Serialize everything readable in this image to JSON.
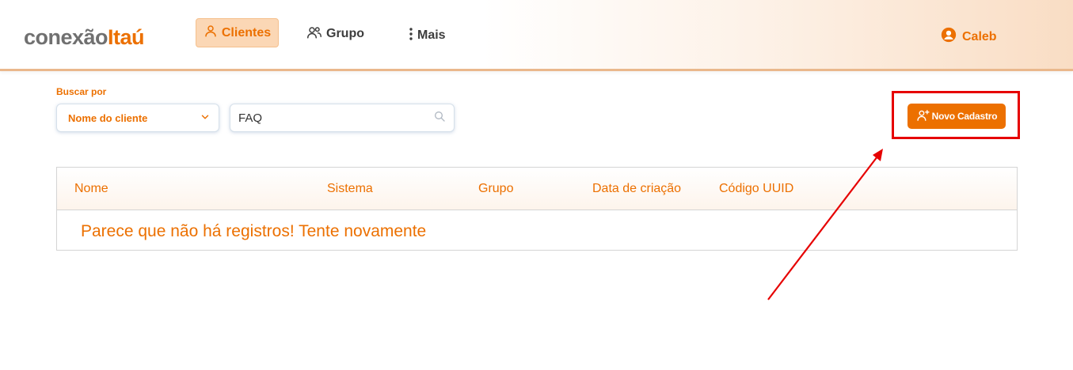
{
  "header": {
    "logo_part1": "conexão",
    "logo_part2": "Itaú",
    "nav": [
      {
        "label": "Clientes",
        "icon": "user-icon",
        "active": true
      },
      {
        "label": "Grupo",
        "icon": "users-icon",
        "active": false
      },
      {
        "label": "Mais",
        "icon": "more-vertical-icon",
        "active": false
      }
    ],
    "user_name": "Caleb"
  },
  "search": {
    "label": "Buscar por",
    "filter_selected": "Nome do cliente",
    "query_value": "FAQ"
  },
  "actions": {
    "new_label": "Novo Cadastro"
  },
  "table": {
    "columns": [
      "Nome",
      "Sistema",
      "Grupo",
      "Data de criação",
      "Código UUID"
    ],
    "empty_message": "Parece que não há registros! Tente novamente"
  },
  "colors": {
    "brand_orange": "#ec7000",
    "annotation_red": "#e60000"
  }
}
